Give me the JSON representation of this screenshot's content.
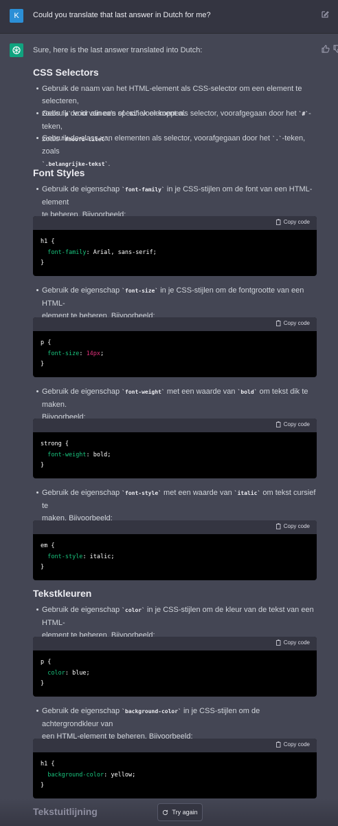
{
  "user": {
    "avatar_letter": "K",
    "message": "Could you translate that last answer in Dutch for me?"
  },
  "assistant": {
    "intro": "Sure, here is the last answer translated into Dutch:",
    "copy_label": "Copy code",
    "sections": [
      {
        "heading": "CSS Selectors"
      },
      {
        "heading": "Font Styles"
      },
      {
        "heading": "Tekstkleuren"
      },
      {
        "heading": "Tekstuitlijning"
      }
    ],
    "bullets": {
      "b1a": "Gebruik de naam van het HTML-element als CSS-selector om een element te selecteren,",
      "b1b_pre": "zoals ",
      "b1b_code1": "`p`",
      "b1b_mid": " voor alinea's of ",
      "b1b_code2": "`h1`",
      "b1b_post": " voor koppen.",
      "b2a_pre": "Gebruik de id van een specifiek element als selector, voorafgegaan door het ",
      "b2a_code": "`#`",
      "b2a_post": "-teken,",
      "b2b_pre": "zoals ",
      "b2b_code": "`#hoofd-titel`",
      "b2b_post": ".",
      "b3a_pre": "Gebruik de class van elementen als selector, voorafgegaan door het ",
      "b3a_code": "`.`",
      "b3a_post": "-teken, zoals",
      "b3b_code": "`.belangrijke-tekst`",
      "b3b_post": ".",
      "f1a_pre": "Gebruik de eigenschap ",
      "f1a_code": "`font-family`",
      "f1a_post": " in je CSS-stijlen om de font van een HTML-element",
      "f1b": "te beheren. Bijvoorbeeld:",
      "f2a_pre": "Gebruik de eigenschap ",
      "f2a_code": "`font-size`",
      "f2a_post": " in je CSS-stijlen om de fontgrootte van een HTML-",
      "f2b": "element te beheren. Bijvoorbeeld:",
      "f3a_pre": "Gebruik de eigenschap ",
      "f3a_code": "`font-weight`",
      "f3a_mid": " met een waarde van ",
      "f3a_code2": "`bold`",
      "f3a_post": " om tekst dik te maken.",
      "f3b": "Bijvoorbeeld:",
      "f4a_pre": "Gebruik de eigenschap ",
      "f4a_code": "`font-style`",
      "f4a_mid": " met een waarde van ",
      "f4a_code2": "`italic`",
      "f4a_post": " om tekst cursief te",
      "f4b": "maken. Bijvoorbeeld:",
      "c1a_pre": "Gebruik de eigenschap ",
      "c1a_code": "`color`",
      "c1a_post": " in je CSS-stijlen om de kleur van de tekst van een HTML-",
      "c1b": "element te beheren. Bijvoorbeeld:",
      "c2a_pre": "Gebruik de eigenschap ",
      "c2a_code": "`background-color`",
      "c2a_post": " in je CSS-stijlen om de achtergrondkleur van",
      "c2b": "een HTML-element te beheren. Bijvoorbeeld:"
    },
    "code": {
      "c1": {
        "sel": "h1 {",
        "prop": "font-family",
        "val": ": Arial, sans-serif;",
        "close": "}"
      },
      "c2": {
        "sel": "p {",
        "prop": "font-size",
        "colon": ": ",
        "num": "14px",
        "semi": ";",
        "close": "}"
      },
      "c3": {
        "sel": "strong {",
        "prop": "font-weight",
        "val": ": bold;",
        "close": "}"
      },
      "c4": {
        "sel": "em {",
        "prop": "font-style",
        "val": ": italic;",
        "close": "}"
      },
      "c5": {
        "sel": "p {",
        "prop": "color",
        "val": ": blue;",
        "close": "}"
      },
      "c6": {
        "sel": "h1 {",
        "prop": "background-color",
        "val": ": yellow;",
        "close": "}"
      }
    }
  },
  "try_again_label": "Try again",
  "colors": {
    "page_bg": "#444654",
    "user_bg": "#343541",
    "assistant_avatar": "#10a37f",
    "user_avatar": "#2b8fd6",
    "code_prop": "#19c37d",
    "code_number": "#df3079"
  },
  "icons": [
    "edit-icon",
    "thumbs-up-icon",
    "thumbs-down-icon",
    "copy-icon",
    "refresh-icon",
    "openai-logo-icon"
  ]
}
